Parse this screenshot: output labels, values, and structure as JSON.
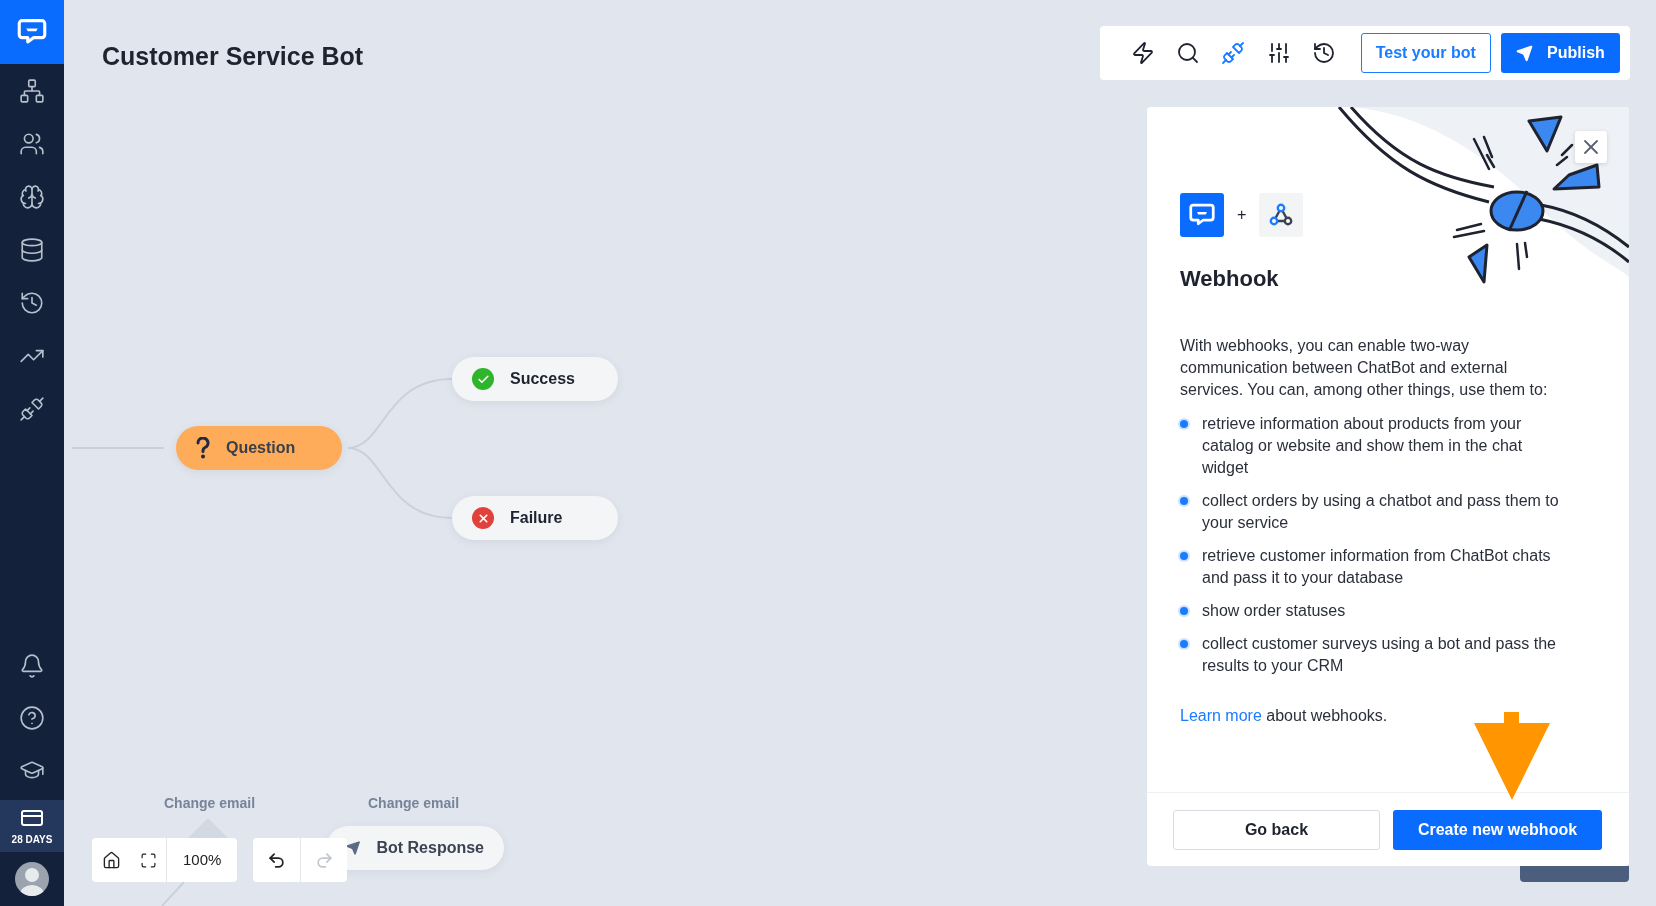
{
  "sidebar": {
    "items": [
      {
        "kind": "flow",
        "selected": false
      },
      {
        "kind": "users",
        "selected": false
      },
      {
        "kind": "brain",
        "selected": false
      },
      {
        "kind": "database",
        "selected": false
      },
      {
        "kind": "history",
        "selected": false
      },
      {
        "kind": "reports",
        "selected": false
      },
      {
        "kind": "integrations",
        "selected": false
      }
    ],
    "bottom_items": [
      {
        "kind": "notifications"
      },
      {
        "kind": "help"
      },
      {
        "kind": "academy"
      }
    ],
    "trial": "28 DAYS"
  },
  "header": {
    "title": "Customer Service Bot"
  },
  "toolbar": {
    "tools": [
      {
        "kind": "actions",
        "selected": false
      },
      {
        "kind": "search",
        "selected": false
      },
      {
        "kind": "integrations",
        "selected": true
      },
      {
        "kind": "settings",
        "selected": false
      },
      {
        "kind": "history",
        "selected": false
      }
    ],
    "test_button": "Test your bot",
    "publish_button": "Publish"
  },
  "canvas": {
    "nodes": [
      {
        "kind": "question",
        "label": "Question"
      },
      {
        "kind": "success",
        "label": "Success"
      },
      {
        "kind": "failure",
        "label": "Failure"
      },
      {
        "kind": "response",
        "label": "Bot Response"
      }
    ],
    "edge_labels": [
      "Change email",
      "Change email"
    ]
  },
  "zoom_controls": {
    "zoom": "100%",
    "redo_disabled": true
  },
  "panel": {
    "plus": "+",
    "title": "Webhook",
    "intro": "With webhooks, you can enable two-way communication between ChatBot and external services. You can, among other things, use them to:",
    "bullets": [
      "retrieve information about products from your catalog or website and show them in the chat widget",
      "collect orders by using a chatbot and pass them to your service",
      "retrieve customer information from ChatBot chats and pass it to your database",
      "show order statuses",
      "collect customer surveys using a bot and pass the results to your CRM"
    ],
    "learn_more": {
      "link": "Learn more",
      "rest": "about webhooks."
    },
    "go_back": "Go back",
    "create": "Create new webhook"
  }
}
